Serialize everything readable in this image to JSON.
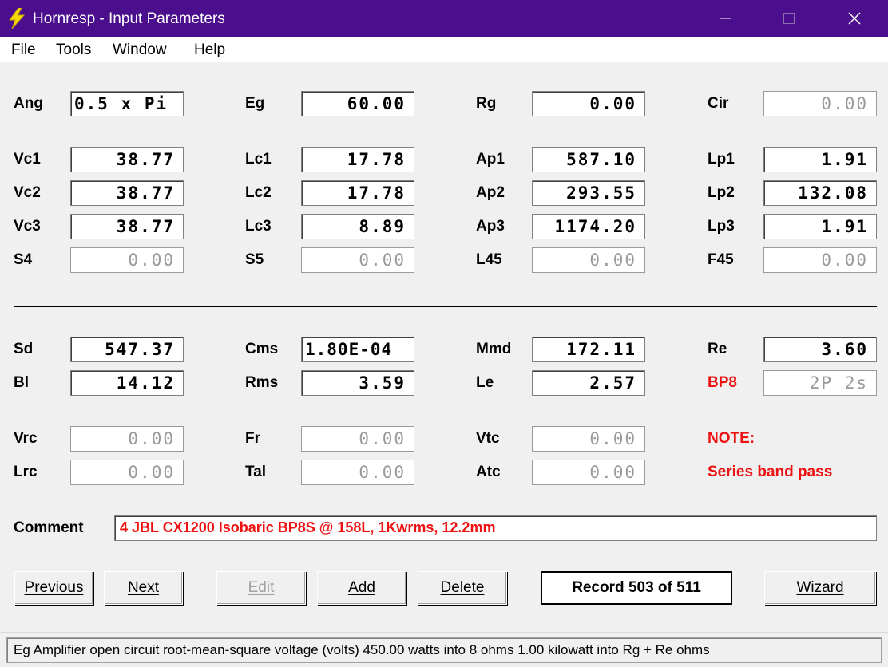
{
  "window": {
    "title": "Hornresp - Input Parameters",
    "controls": [
      "minimize",
      "maximize",
      "close"
    ]
  },
  "menu": {
    "file": "File",
    "tools": "Tools",
    "window": "Window",
    "help": "Help"
  },
  "params": {
    "ang": {
      "label": "Ang",
      "value": "0.5 x Pi"
    },
    "eg": {
      "label": "Eg",
      "value": "60.00"
    },
    "rg": {
      "label": "Rg",
      "value": "0.00"
    },
    "cir": {
      "label": "Cir",
      "value": "0.00"
    },
    "vc1": {
      "label": "Vc1",
      "value": "38.77"
    },
    "lc1": {
      "label": "Lc1",
      "value": "17.78"
    },
    "ap1": {
      "label": "Ap1",
      "value": "587.10"
    },
    "lp1": {
      "label": "Lp1",
      "value": "1.91"
    },
    "vc2": {
      "label": "Vc2",
      "value": "38.77"
    },
    "lc2": {
      "label": "Lc2",
      "value": "17.78"
    },
    "ap2": {
      "label": "Ap2",
      "value": "293.55"
    },
    "lp2": {
      "label": "Lp2",
      "value": "132.08"
    },
    "vc3": {
      "label": "Vc3",
      "value": "38.77"
    },
    "lc3": {
      "label": "Lc3",
      "value": "8.89"
    },
    "ap3": {
      "label": "Ap3",
      "value": "1174.20"
    },
    "lp3": {
      "label": "Lp3",
      "value": "1.91"
    },
    "s4": {
      "label": "S4",
      "value": "0.00"
    },
    "s5": {
      "label": "S5",
      "value": "0.00"
    },
    "l45": {
      "label": "L45",
      "value": "0.00"
    },
    "f45": {
      "label": "F45",
      "value": "0.00"
    },
    "sd": {
      "label": "Sd",
      "value": "547.37"
    },
    "cms": {
      "label": "Cms",
      "value": "1.80E-04"
    },
    "mmd": {
      "label": "Mmd",
      "value": "172.11"
    },
    "re": {
      "label": "Re",
      "value": "3.60"
    },
    "bl": {
      "label": "Bl",
      "value": "14.12"
    },
    "rms": {
      "label": "Rms",
      "value": "3.59"
    },
    "le": {
      "label": "Le",
      "value": "2.57"
    },
    "bp8": {
      "label": "BP8",
      "value": "2P 2s"
    },
    "vrc": {
      "label": "Vrc",
      "value": "0.00"
    },
    "fr": {
      "label": "Fr",
      "value": "0.00"
    },
    "vtc": {
      "label": "Vtc",
      "value": "0.00"
    },
    "lrc": {
      "label": "Lrc",
      "value": "0.00"
    },
    "tal": {
      "label": "Tal",
      "value": "0.00"
    },
    "atc": {
      "label": "Atc",
      "value": "0.00"
    }
  },
  "note": {
    "label": "NOTE:",
    "text": "Series band pass"
  },
  "comment": {
    "label": "Comment",
    "value": "4 JBL CX1200 Isobaric BP8S @ 158L, 1Kwrms, 12.2mm"
  },
  "buttons": {
    "previous": "Previous",
    "next": "Next",
    "edit": "Edit",
    "add": "Add",
    "delete": "Delete",
    "wizard": "Wizard"
  },
  "record": "Record 503 of 511",
  "status": "Eg  Amplifier open circuit root-mean-square voltage  (volts)   450.00 watts into 8 ohms   1.00 kilowatt into Rg + Re ohms",
  "colors": {
    "titlebar": "#4b0f8e",
    "accent_red": "#ee1111"
  }
}
